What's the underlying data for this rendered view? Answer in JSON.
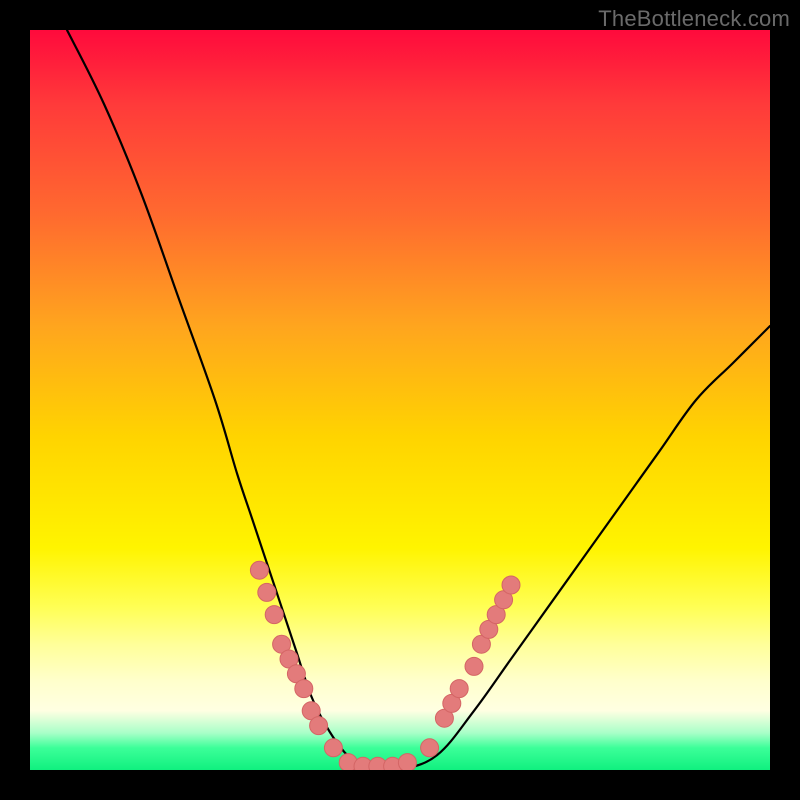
{
  "watermark": "TheBottleneck.com",
  "colors": {
    "background": "#000000",
    "curve": "#000000",
    "marker_fill": "#e37b7b",
    "marker_stroke": "#d46565"
  },
  "chart_data": {
    "type": "line",
    "title": "",
    "xlabel": "",
    "ylabel": "",
    "xlim": [
      0,
      100
    ],
    "ylim": [
      0,
      100
    ],
    "grid": false,
    "legend": false,
    "note": "Axes have no tick labels in the source image; values are estimated on a 0–100 normalized scale where y is 'bottleneck' (0 = green bottom, 100 = red top).",
    "series": [
      {
        "name": "bottleneck-curve",
        "x": [
          5,
          10,
          15,
          20,
          25,
          28,
          30,
          32,
          34,
          36,
          38,
          40,
          42,
          44,
          46,
          48,
          50,
          55,
          60,
          65,
          70,
          75,
          80,
          85,
          90,
          95,
          100
        ],
        "y": [
          100,
          90,
          78,
          64,
          50,
          40,
          34,
          28,
          22,
          16,
          10,
          6,
          3,
          1,
          0,
          0,
          0,
          2,
          8,
          15,
          22,
          29,
          36,
          43,
          50,
          55,
          60
        ]
      }
    ],
    "markers": {
      "name": "highlighted-points",
      "note": "Salmon circular markers clustered near the bottom of the V; positions estimated on the same 0–100 scale.",
      "points": [
        {
          "x": 31,
          "y": 27
        },
        {
          "x": 32,
          "y": 24
        },
        {
          "x": 33,
          "y": 21
        },
        {
          "x": 34,
          "y": 17
        },
        {
          "x": 35,
          "y": 15
        },
        {
          "x": 36,
          "y": 13
        },
        {
          "x": 37,
          "y": 11
        },
        {
          "x": 38,
          "y": 8
        },
        {
          "x": 39,
          "y": 6
        },
        {
          "x": 41,
          "y": 3
        },
        {
          "x": 43,
          "y": 1
        },
        {
          "x": 45,
          "y": 0.5
        },
        {
          "x": 47,
          "y": 0.5
        },
        {
          "x": 49,
          "y": 0.5
        },
        {
          "x": 51,
          "y": 1
        },
        {
          "x": 54,
          "y": 3
        },
        {
          "x": 56,
          "y": 7
        },
        {
          "x": 57,
          "y": 9
        },
        {
          "x": 58,
          "y": 11
        },
        {
          "x": 60,
          "y": 14
        },
        {
          "x": 61,
          "y": 17
        },
        {
          "x": 62,
          "y": 19
        },
        {
          "x": 63,
          "y": 21
        },
        {
          "x": 64,
          "y": 23
        },
        {
          "x": 65,
          "y": 25
        }
      ]
    }
  }
}
